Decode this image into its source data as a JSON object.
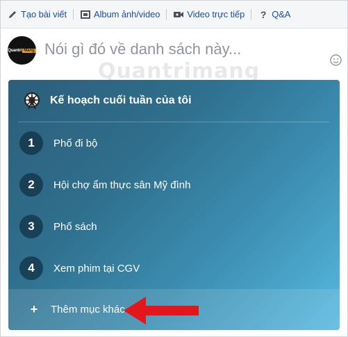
{
  "tabs": [
    {
      "label": "Tạo bài viết",
      "icon": "pencil-icon"
    },
    {
      "label": "Album ảnh/video",
      "icon": "photo-album-icon"
    },
    {
      "label": "Video trực tiếp",
      "icon": "video-camera-icon"
    },
    {
      "label": "Q&A",
      "icon": "question-icon"
    }
  ],
  "composer": {
    "placeholder": "Nói gì đó về danh sách này...",
    "avatar_text_a": "QuantriMang",
    "avatar_text_b": "Mang"
  },
  "watermark": "Quantrimang",
  "card": {
    "title": "Kế hoạch cuối tuần của tôi",
    "items": [
      {
        "number": "1",
        "label": "Phố đi bộ"
      },
      {
        "number": "2",
        "label": "Hội chợ ẩm thực sân Mỹ đình"
      },
      {
        "number": "3",
        "label": "Phố sách"
      },
      {
        "number": "4",
        "label": "Xem phim tại CGV"
      }
    ],
    "add_label": "Thêm mục khác",
    "add_symbol": "+"
  },
  "colors": {
    "tab_text": "#1c4fa0",
    "card_gradient_start": "#2c5e7a",
    "card_gradient_end": "#57b9e0",
    "arrow": "#e3161b"
  }
}
